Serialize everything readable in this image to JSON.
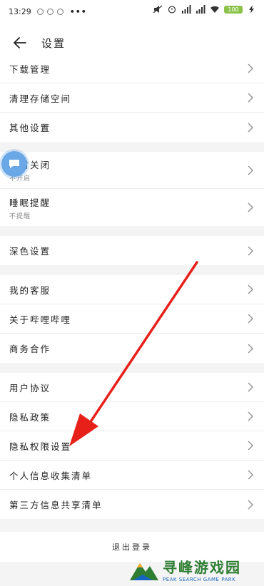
{
  "status_bar": {
    "time": "13:29",
    "more": "•••",
    "battery": "100"
  },
  "header": {
    "title": "设置"
  },
  "groups": [
    {
      "items": [
        {
          "label": "下载管理"
        },
        {
          "label": "清理存储空间"
        },
        {
          "label": "其他设置"
        }
      ]
    },
    {
      "items": [
        {
          "label": "定时关闭",
          "sub": "不开启"
        },
        {
          "label": "睡眠提醒",
          "sub": "不提醒"
        }
      ]
    },
    {
      "items": [
        {
          "label": "深色设置"
        }
      ]
    },
    {
      "items": [
        {
          "label": "我的客服"
        },
        {
          "label": "关于哔哩哔哩"
        },
        {
          "label": "商务合作"
        }
      ]
    },
    {
      "items": [
        {
          "label": "用户协议"
        },
        {
          "label": "隐私政策"
        },
        {
          "label": "隐私权限设置"
        },
        {
          "label": "个人信息收集清单"
        },
        {
          "label": "第三方信息共享清单"
        }
      ]
    }
  ],
  "logout": {
    "label": "退出登录"
  },
  "watermark": {
    "main": "寻峰游戏园",
    "sub": "PEAK SEARCH GAME PARK"
  },
  "colors": {
    "annotation_arrow": "#e8201a",
    "float_bubble": "#6aa7e6",
    "watermark_green": "#2e7d32"
  }
}
